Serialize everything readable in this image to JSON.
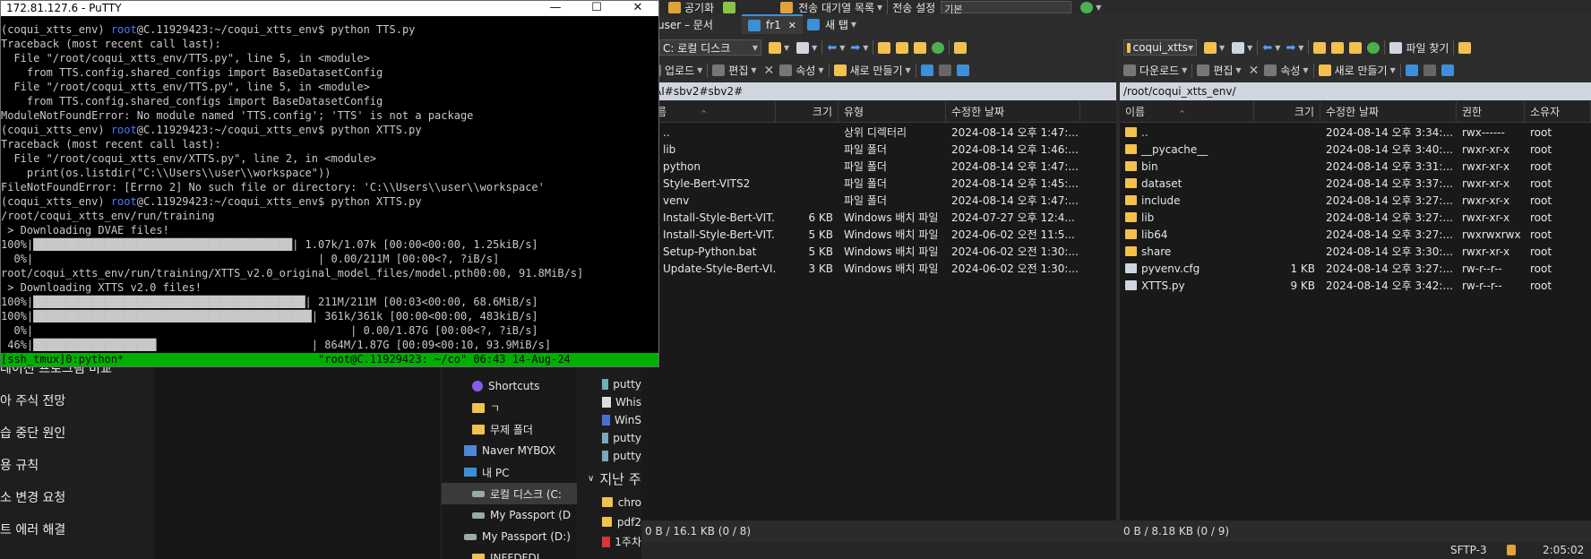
{
  "putty": {
    "title": "172.81.127.6 - PuTTY",
    "minimize": "—",
    "maximize": "☐",
    "close": "✕",
    "lines": [
      {
        "env": "(coqui_xtts_env) ",
        "user": "root",
        "rest": "@C.11929423:~/coqui_xtts_env$ python TTS.py"
      },
      {
        "text": "Traceback (most recent call last):"
      },
      {
        "text": "  File \"/root/coqui_xtts_env/TTS.py\", line 5, in <module>"
      },
      {
        "text": "    from TTS.config.shared_configs import BaseDatasetConfig"
      },
      {
        "text": "  File \"/root/coqui_xtts_env/TTS.py\", line 5, in <module>"
      },
      {
        "text": "    from TTS.config.shared_configs import BaseDatasetConfig"
      },
      {
        "text": "ModuleNotFoundError: No module named 'TTS.config'; 'TTS' is not a package"
      },
      {
        "env": "(coqui_xtts_env) ",
        "user": "root",
        "rest": "@C.11929423:~/coqui_xtts_env$ python XTTS.py"
      },
      {
        "text": "Traceback (most recent call last):"
      },
      {
        "text": "  File \"/root/coqui_xtts_env/XTTS.py\", line 2, in <module>"
      },
      {
        "text": "    print(os.listdir(\"C:\\\\Users\\\\user\\\\workspace\"))"
      },
      {
        "text": "FileNotFoundError: [Errno 2] No such file or directory: 'C:\\\\Users\\\\user\\\\workspace'"
      },
      {
        "env": "(coqui_xtts_env) ",
        "user": "root",
        "rest": "@C.11929423:~/coqui_xtts_env$ python XTTS.py"
      },
      {
        "text": "/root/coqui_xtts_env/run/training"
      },
      {
        "text": " > Downloading DVAE files!"
      },
      {
        "text": "100%|████████████████████████████████████████| 1.07k/1.07k [00:00<00:00, 1.25kiB/s]"
      },
      {
        "text": "  0%|                                            | 0.00/211M [00:00<?, ?iB/s]"
      },
      {
        "text": "root/coqui_xtts_env/run/training/XTTS_v2.0_original_model_files/model.pth00:00, 91.8MiB/s]"
      },
      {
        "text": " > Downloading XTTS v2.0 files!"
      },
      {
        "text": "100%|██████████████████████████████████████████| 211M/211M [00:03<00:00, 68.6MiB/s]"
      },
      {
        "text": "100%|███████████████████████████████████████████| 361k/361k [00:00<00:00, 483kiB/s]"
      },
      {
        "text": "  0%|                                                 | 0.00/1.87G [00:00<?, ?iB/s]"
      },
      {
        "text": " 46%|███████████████████                        | 864M/1.87G [00:09<00:10, 93.9MiB/s]"
      }
    ],
    "tmux_status": "[ssh_tmux]0:python*                              \"root@C.11929423: ~/co\" 06:43 14-Aug-24"
  },
  "background_chat": {
    "items": [
      "레이션 프로그램 비교",
      "아 주식 전망",
      "습 중단 원인",
      "용 규칙",
      "소 변경 요청",
      "트 에러 해결"
    ]
  },
  "background_tree": {
    "items": [
      "Shortcuts",
      "ㄱ",
      "무제 폴더",
      "Naver MYBOX",
      "내 PC",
      "로컬 디스크 (C:",
      "My Passport (D",
      "My Passport (D:)",
      "INFFDFDI"
    ]
  },
  "background_files": {
    "items": [
      "putty",
      "Whis",
      "WinS",
      "putty",
      "putty"
    ],
    "group_label": "지난 주",
    "items_after": [
      "chro",
      "pdf2",
      "1주차"
    ]
  },
  "winscp": {
    "top_row": {
      "tab_label": "user – 문서",
      "sync_label": "공기화",
      "transfer_label": "전송 대기열 목록",
      "transfer_settings_label": "전송 설정",
      "transfer_settings_value": "기본"
    },
    "tabs": [
      "fr1",
      "새 탭"
    ],
    "local": {
      "drive": "C: 로컬 디스크",
      "toolbar": {
        "upload": "업로드",
        "edit": "편집",
        "properties": "속성",
        "new": "새로 만들기"
      },
      "path": "#AI#sbv2#sbv2#",
      "columns": [
        "이름",
        "크기",
        "유형",
        "수정한 날짜"
      ],
      "rows": [
        {
          "name": "..",
          "size": "",
          "type": "상위 디렉터리",
          "date": "2024-08-14 오후 1:47:..."
        },
        {
          "name": "lib",
          "size": "",
          "type": "파일 폴더",
          "date": "2024-08-14 오후 1:46:..."
        },
        {
          "name": "python",
          "size": "",
          "type": "파일 폴더",
          "date": "2024-08-14 오후 1:47:..."
        },
        {
          "name": "Style-Bert-VITS2",
          "size": "",
          "type": "파일 폴더",
          "date": "2024-08-14 오후 1:45:..."
        },
        {
          "name": "venv",
          "size": "",
          "type": "파일 폴더",
          "date": "2024-08-14 오후 1:47:..."
        },
        {
          "name": "Install-Style-Bert-VIT...",
          "size": "6 KB",
          "type": "Windows 배치 파일",
          "date": "2024-07-27 오후 12:4..."
        },
        {
          "name": "Install-Style-Bert-VIT...",
          "size": "5 KB",
          "type": "Windows 배치 파일",
          "date": "2024-06-02 오전 11:5..."
        },
        {
          "name": "Setup-Python.bat",
          "size": "5 KB",
          "type": "Windows 배치 파일",
          "date": "2024-06-02 오전 1:30:..."
        },
        {
          "name": "Update-Style-Bert-VI...",
          "size": "3 KB",
          "type": "Windows 배치 파일",
          "date": "2024-06-02 오전 1:30:..."
        }
      ],
      "status": "0 B / 16.1 KB (0 / 8)"
    },
    "remote": {
      "drive": "coqui_xtts",
      "find_files": "파일 찾기",
      "toolbar": {
        "download": "다운로드",
        "edit": "편집",
        "properties": "속성",
        "new": "새로 만들기"
      },
      "path": "/root/coqui_xtts_env/",
      "columns": [
        "이름",
        "크기",
        "수정한 날짜",
        "권한",
        "소유자"
      ],
      "rows": [
        {
          "name": "..",
          "size": "",
          "date": "2024-08-14 오후 3:34:...",
          "perm": "rwx------",
          "owner": "root"
        },
        {
          "name": "__pycache__",
          "size": "",
          "date": "2024-08-14 오후 3:40:...",
          "perm": "rwxr-xr-x",
          "owner": "root"
        },
        {
          "name": "bin",
          "size": "",
          "date": "2024-08-14 오후 3:31:...",
          "perm": "rwxr-xr-x",
          "owner": "root"
        },
        {
          "name": "dataset",
          "size": "",
          "date": "2024-08-14 오후 3:37:...",
          "perm": "rwxr-xr-x",
          "owner": "root"
        },
        {
          "name": "include",
          "size": "",
          "date": "2024-08-14 오후 3:27:...",
          "perm": "rwxr-xr-x",
          "owner": "root"
        },
        {
          "name": "lib",
          "size": "",
          "date": "2024-08-14 오후 3:27:...",
          "perm": "rwxr-xr-x",
          "owner": "root"
        },
        {
          "name": "lib64",
          "size": "",
          "date": "2024-08-14 오후 3:27:...",
          "perm": "rwxrwxrwx",
          "owner": "root"
        },
        {
          "name": "share",
          "size": "",
          "date": "2024-08-14 오후 3:30:...",
          "perm": "rwxr-xr-x",
          "owner": "root"
        },
        {
          "name": "pyvenv.cfg",
          "size": "1 KB",
          "date": "2024-08-14 오후 3:27:...",
          "perm": "rw-r--r--",
          "owner": "root"
        },
        {
          "name": "XTTS.py",
          "size": "9 KB",
          "date": "2024-08-14 오후 3:42:...",
          "perm": "rw-r--r--",
          "owner": "root"
        }
      ],
      "status": "0 B / 8.18 KB (0 / 9)"
    },
    "bottom": {
      "protocol": "SFTP-3",
      "time": "2:05:02"
    }
  },
  "colors": {
    "terminal_bg": "#000000",
    "tmux_green": "#00b000",
    "root_blue": "#4f78ff",
    "path_bar": "#cfd6df",
    "folder": "#f2c14e"
  }
}
